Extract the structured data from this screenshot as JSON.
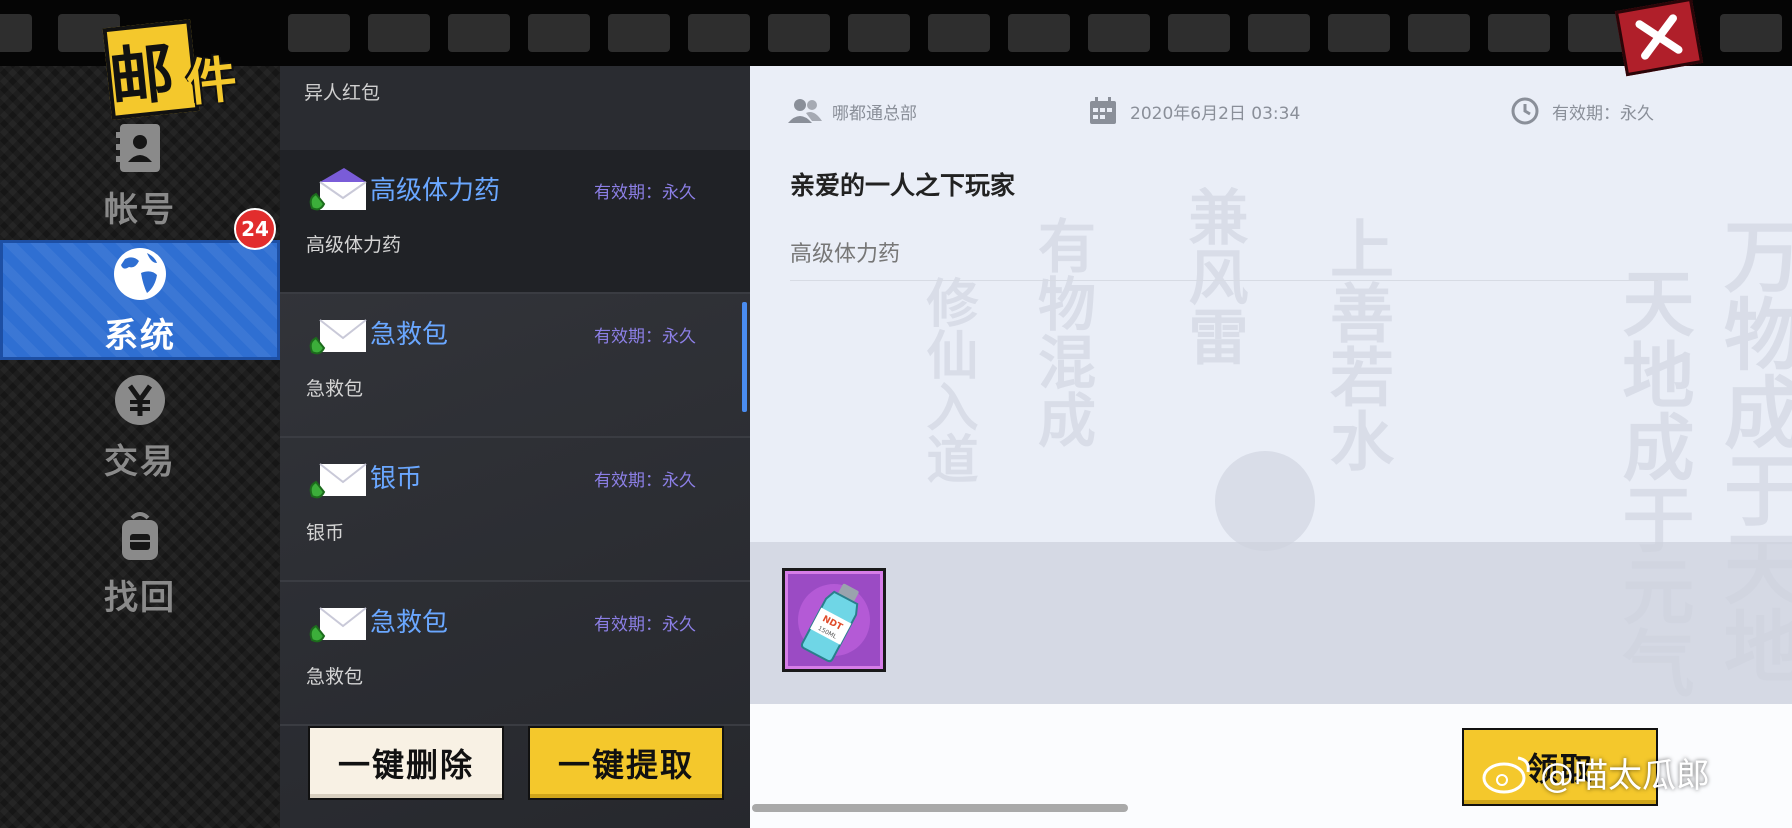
{
  "app": {
    "title_main": "邮",
    "title_second": "件"
  },
  "nav": {
    "items": [
      {
        "label": "帐号",
        "icon": "contact-card-icon"
      },
      {
        "label": "系统",
        "icon": "globe-icon",
        "badge": "24",
        "active": true
      },
      {
        "label": "交易",
        "icon": "yen-coin-icon"
      },
      {
        "label": "找回",
        "icon": "backpack-icon"
      }
    ]
  },
  "mail_list": {
    "header": "异人红包",
    "items": [
      {
        "title": "高级体力药",
        "validity": "有效期：永久",
        "subtitle": "高级体力药",
        "selected": true,
        "opened": true
      },
      {
        "title": "急救包",
        "validity": "有效期：永久",
        "subtitle": "急救包"
      },
      {
        "title": "银币",
        "validity": "有效期：永久",
        "subtitle": "银币"
      },
      {
        "title": "急救包",
        "validity": "有效期：永久",
        "subtitle": "急救包"
      }
    ],
    "buttons": {
      "delete_all": "一键删除",
      "extract_all": "一键提取"
    }
  },
  "detail": {
    "sender": "哪都通总部",
    "date": "2020年6月2日  03:34",
    "validity": "有效期：永久",
    "greeting": "亲爱的一人之下玩家",
    "body": "高级体力药",
    "attachment": {
      "icon": "potion-bottle-icon",
      "label": "NDT",
      "sublabel": "150ML"
    },
    "claim_button": "领取"
  },
  "watermark": "@喵太瓜郎",
  "colors": {
    "accent_blue": "#2f6fd2",
    "button_yellow": "#f4c82c",
    "badge_red": "#e22d2d",
    "validity_purple": "#8c7fe6",
    "title_blue": "#6aa7ff"
  }
}
